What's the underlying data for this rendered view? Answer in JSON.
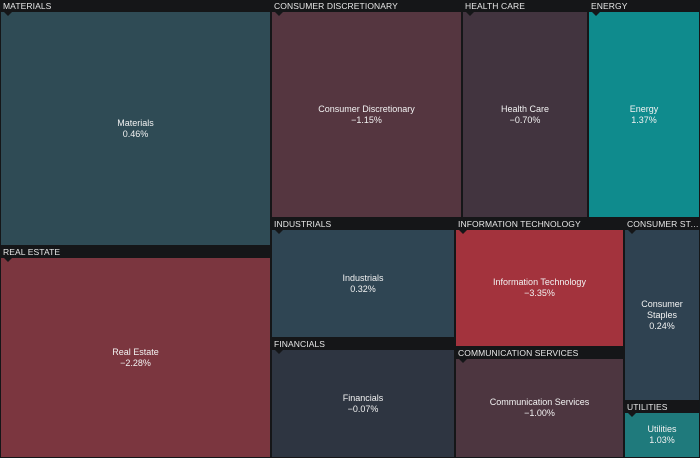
{
  "chart_data": {
    "type": "treemap",
    "colors": {
      "background": "#151618",
      "negative_strong": "#a3333d",
      "negative_mid": "#7b363f",
      "negative_weak": "#553640",
      "negative_faint": "#42343f",
      "neutral": "#2e3541",
      "positive_weak": "#2f4553",
      "positive_mid": "#2c5058",
      "positive_strong": "#0f8b8d",
      "positive_alt": "#1f7a7c"
    },
    "sectors": [
      {
        "header": "MATERIALS",
        "label": "Materials",
        "value": "0.46%",
        "change": 0.46,
        "color": "#2f4b55"
      },
      {
        "header": "REAL ESTATE",
        "label": "Real Estate",
        "value": "−2.28%",
        "change": -2.28,
        "color": "#7b363f"
      },
      {
        "header": "CONSUMER DISCRETIONARY",
        "label": "Consumer Discretionary",
        "value": "−1.15%",
        "change": -1.15,
        "color": "#553640"
      },
      {
        "header": "HEALTH CARE",
        "label": "Health Care",
        "value": "−0.70%",
        "change": -0.7,
        "color": "#42343f"
      },
      {
        "header": "ENERGY",
        "label": "Energy",
        "value": "1.37%",
        "change": 1.37,
        "color": "#0f8b8d"
      },
      {
        "header": "INDUSTRIALS",
        "label": "Industrials",
        "value": "0.32%",
        "change": 0.32,
        "color": "#2f4553"
      },
      {
        "header": "FINANCIALS",
        "label": "Financials",
        "value": "−0.07%",
        "change": -0.07,
        "color": "#2e3541"
      },
      {
        "header": "INFORMATION TECHNOLOGY",
        "label": "Information Technology",
        "value": "−3.35%",
        "change": -3.35,
        "color": "#a3333d"
      },
      {
        "header": "COMMUNICATION SERVICES",
        "label": "Communication Services",
        "value": "−1.00%",
        "change": -1.0,
        "color": "#4d3640"
      },
      {
        "header": "CONSUMER STAPLES",
        "label": "Consumer Staples",
        "value": "0.24%",
        "change": 0.24,
        "color": "#2f4251"
      },
      {
        "header": "UTILITIES",
        "label": "Utilities",
        "value": "1.03%",
        "change": 1.03,
        "color": "#1f7a7c"
      }
    ]
  }
}
